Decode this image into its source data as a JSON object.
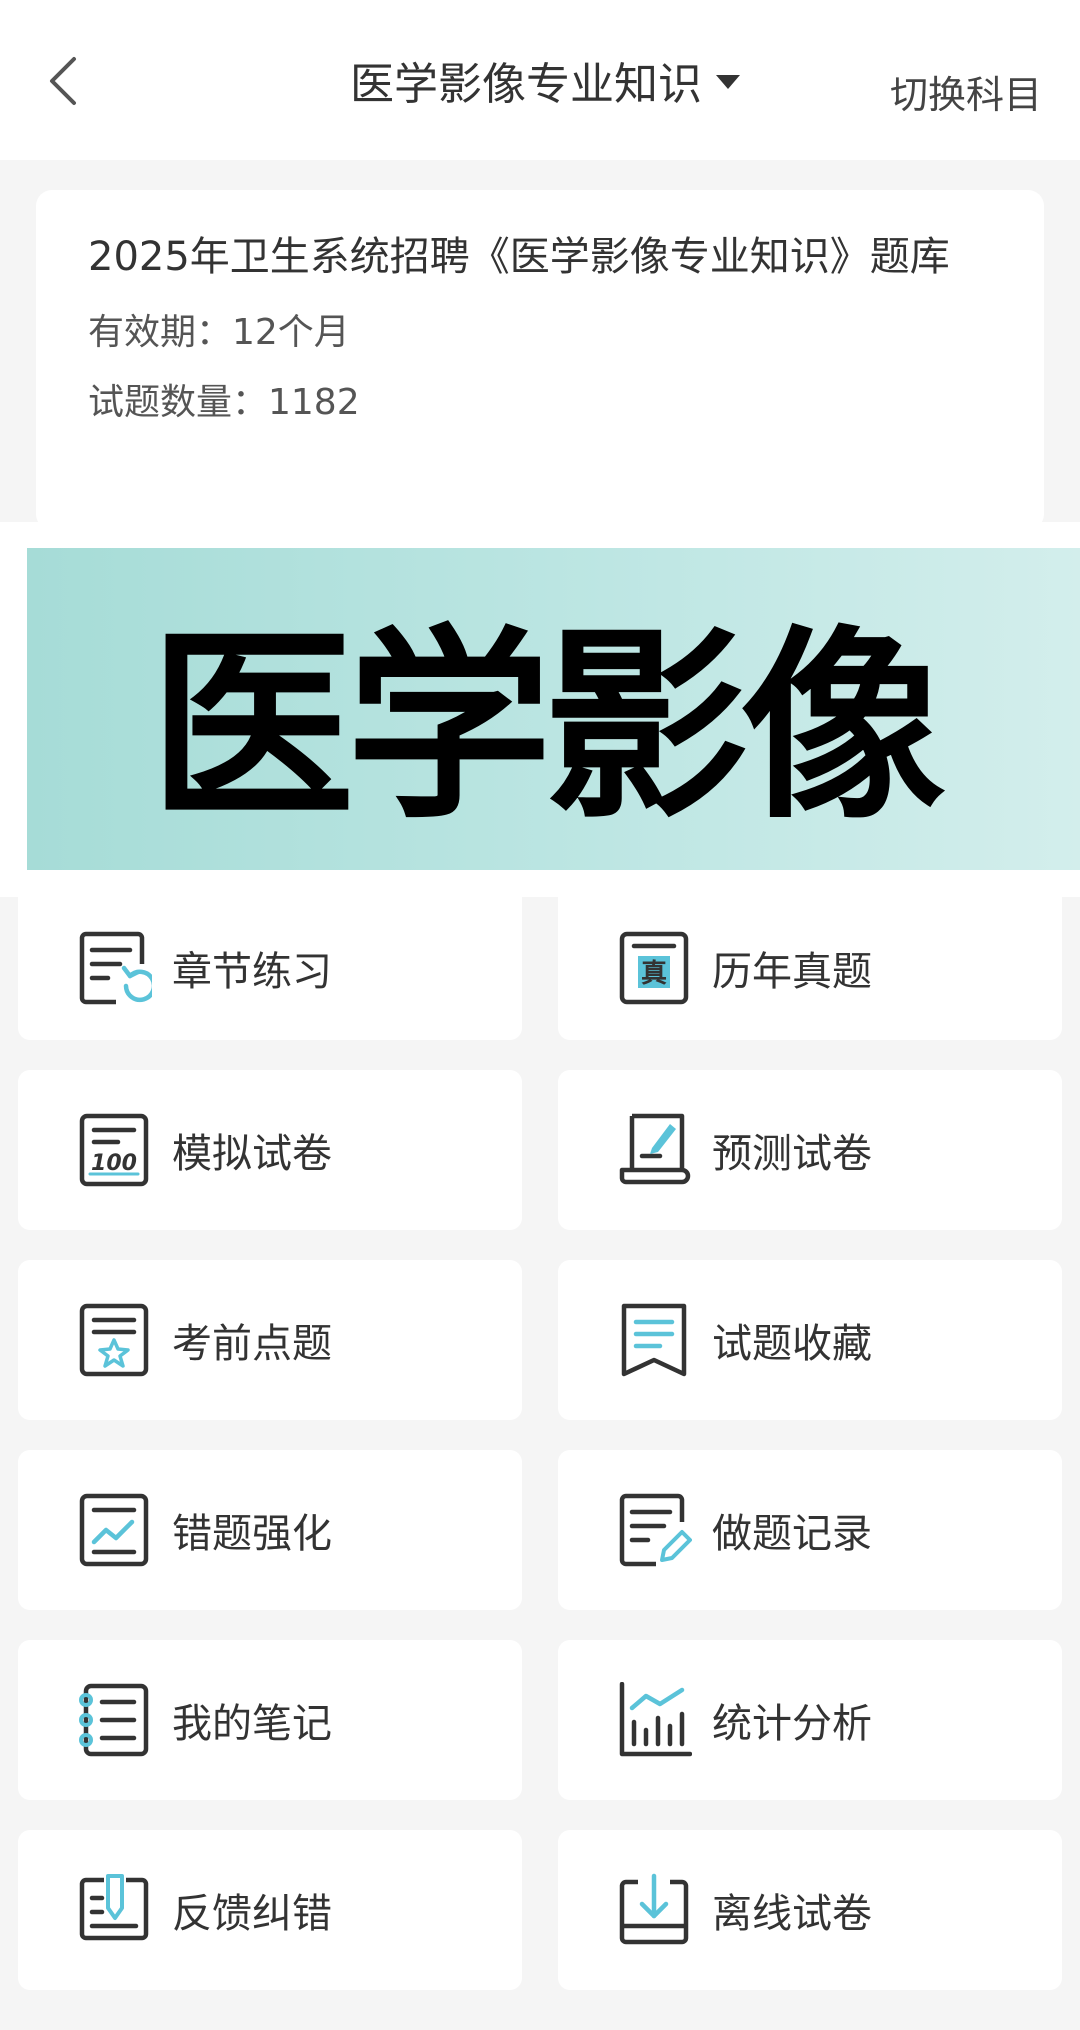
{
  "header": {
    "title": "医学影像专业知识",
    "switch_label": "切换科目"
  },
  "info": {
    "title": "2025年卫生系统招聘《医学影像专业知识》题库",
    "validity": "有效期：12个月",
    "count": "试题数量：1182"
  },
  "banner": {
    "text": "医学影像"
  },
  "menu": [
    {
      "label": "章节练习",
      "icon": "chapter-practice-icon"
    },
    {
      "label": "历年真题",
      "icon": "past-exams-icon"
    },
    {
      "label": "模拟试卷",
      "icon": "mock-exam-icon"
    },
    {
      "label": "预测试卷",
      "icon": "prediction-exam-icon"
    },
    {
      "label": "考前点题",
      "icon": "pre-exam-tips-icon"
    },
    {
      "label": "试题收藏",
      "icon": "favorites-icon"
    },
    {
      "label": "错题强化",
      "icon": "wrong-questions-icon"
    },
    {
      "label": "做题记录",
      "icon": "practice-record-icon"
    },
    {
      "label": "我的笔记",
      "icon": "notes-icon"
    },
    {
      "label": "统计分析",
      "icon": "statistics-icon"
    },
    {
      "label": "反馈纠错",
      "icon": "feedback-icon"
    },
    {
      "label": "离线试卷",
      "icon": "offline-exam-icon"
    }
  ],
  "colors": {
    "accent": "#5bc3d9",
    "icon_stroke": "#333333",
    "banner_start": "#a6dcd7",
    "banner_end": "#d3eeec"
  }
}
